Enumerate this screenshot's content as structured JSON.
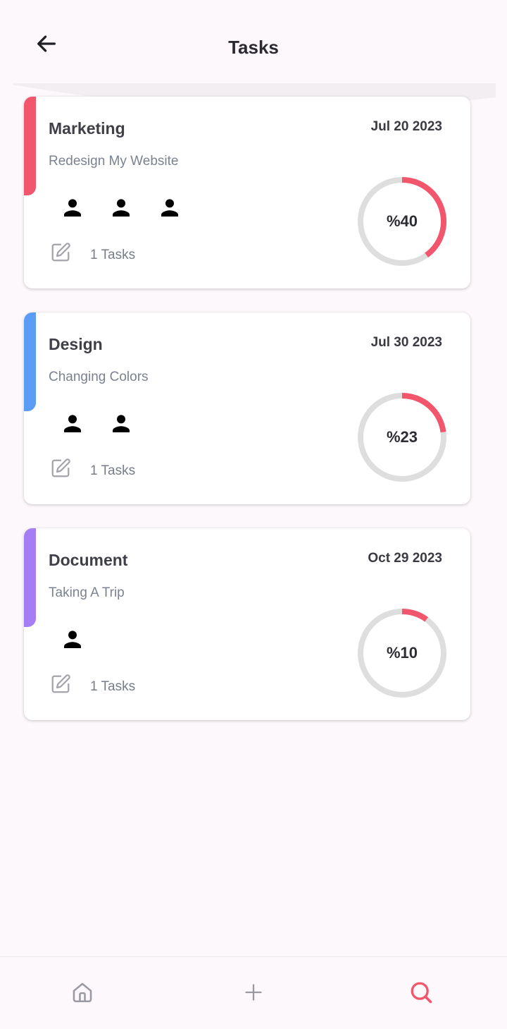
{
  "header": {
    "title": "Tasks"
  },
  "colors": {
    "progress": "#f2566d",
    "track": "#dedede",
    "nav_active": "#f2566d",
    "nav_inactive": "#9a9aa2"
  },
  "cards": [
    {
      "category": "Marketing",
      "date": "Jul 20 2023",
      "subtitle": "Redesign My Website",
      "members": 3,
      "tasks_label": "1 Tasks",
      "progress_label": "%40",
      "progress": 0.4,
      "accent": "#f2566d"
    },
    {
      "category": "Design",
      "date": "Jul 30 2023",
      "subtitle": "Changing Colors",
      "members": 2,
      "tasks_label": "1 Tasks",
      "progress_label": "%23",
      "progress": 0.23,
      "accent": "#5b9cf6"
    },
    {
      "category": "Document",
      "date": "Oct 29 2023",
      "subtitle": "Taking A Trip",
      "members": 1,
      "tasks_label": "1 Tasks",
      "progress_label": "%10",
      "progress": 0.1,
      "accent": "#a57ef6"
    }
  ],
  "bottom_nav": {
    "items": [
      {
        "icon": "home-icon",
        "active": false
      },
      {
        "icon": "plus-icon",
        "active": false
      },
      {
        "icon": "search-icon",
        "active": true
      }
    ]
  }
}
